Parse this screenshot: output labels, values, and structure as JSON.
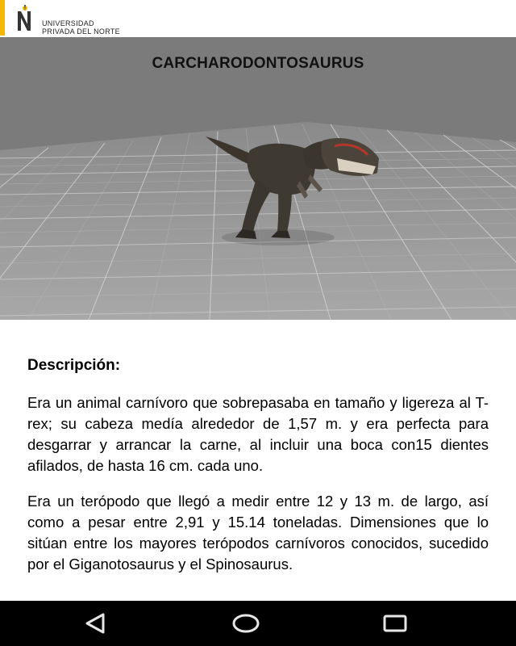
{
  "header": {
    "logo_line1": "UNIVERSIDAD",
    "logo_line2": "PRIVADA DEL NORTE",
    "accent_color": "#f5b700"
  },
  "viewer": {
    "title": "CARCHARODONTOSAURUS",
    "model_icon": "dinosaur-model",
    "background_color": "#7b7b7b"
  },
  "content": {
    "heading": "Descripción:",
    "paragraphs": [
      "Era un animal carnívoro que sobrepasaba en tamaño y ligereza al T-rex; su cabeza medía alrededor de 1,57 m. y era perfecta para desgarrar y arrancar la carne, al incluir una boca con15 dientes afilados, de hasta 16 cm. cada uno.",
      "Era un terópodo que llegó a medir entre 12 y 13 m. de largo, así como a pesar entre 2,91 y 15.14 toneladas. Dimensiones que lo sitúan entre los mayores terópodos carnívoros conocidos, sucedido por el Giganotosaurus y el Spinosaurus."
    ]
  },
  "navbar": {
    "back_icon": "back-triangle-icon",
    "home_icon": "home-circle-icon",
    "recents_icon": "recents-square-icon"
  }
}
